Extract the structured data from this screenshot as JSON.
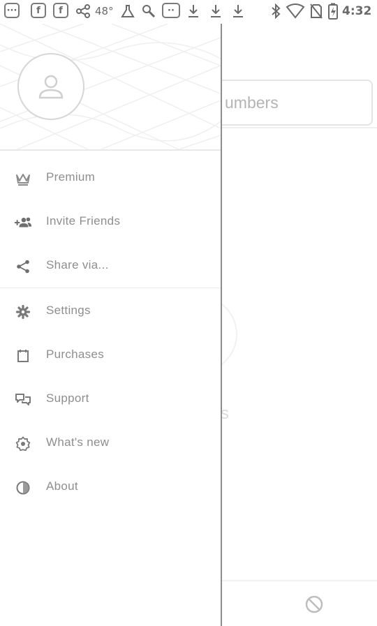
{
  "status_bar": {
    "notification_icons": [
      "chat-bubble-icon",
      "facebook-icon",
      "facebook-icon",
      "share-icon"
    ],
    "temperature": "48°",
    "more_icons": [
      "flask-icon",
      "wrench-icon",
      "chat-bubble-icon",
      "download-icon",
      "download-icon",
      "download-icon"
    ],
    "system_icons": [
      "bluetooth-icon",
      "wifi-icon",
      "no-sim-icon",
      "battery-charging-icon"
    ],
    "time": "4:32"
  },
  "background_app": {
    "search_placeholder_fragment": "umbers",
    "content_fragment": "s"
  },
  "drawer": {
    "menu_primary": [
      {
        "label": "Premium",
        "icon": "crown-icon"
      },
      {
        "label": "Invite Friends",
        "icon": "add-people-icon"
      },
      {
        "label": "Share via...",
        "icon": "share-icon"
      }
    ],
    "menu_secondary": [
      {
        "label": "Settings",
        "icon": "gear-icon"
      },
      {
        "label": "Purchases",
        "icon": "purchases-icon"
      },
      {
        "label": "Support",
        "icon": "support-chat-icon"
      },
      {
        "label": "What's new",
        "icon": "new-badge-icon"
      },
      {
        "label": "About",
        "icon": "info-icon"
      }
    ]
  },
  "colors": {
    "background": "#ffffff",
    "text": "#8e8e8e",
    "icon": "#8a8a8a",
    "divider": "#ececec",
    "drawer_edge": "#8c8c8c"
  }
}
